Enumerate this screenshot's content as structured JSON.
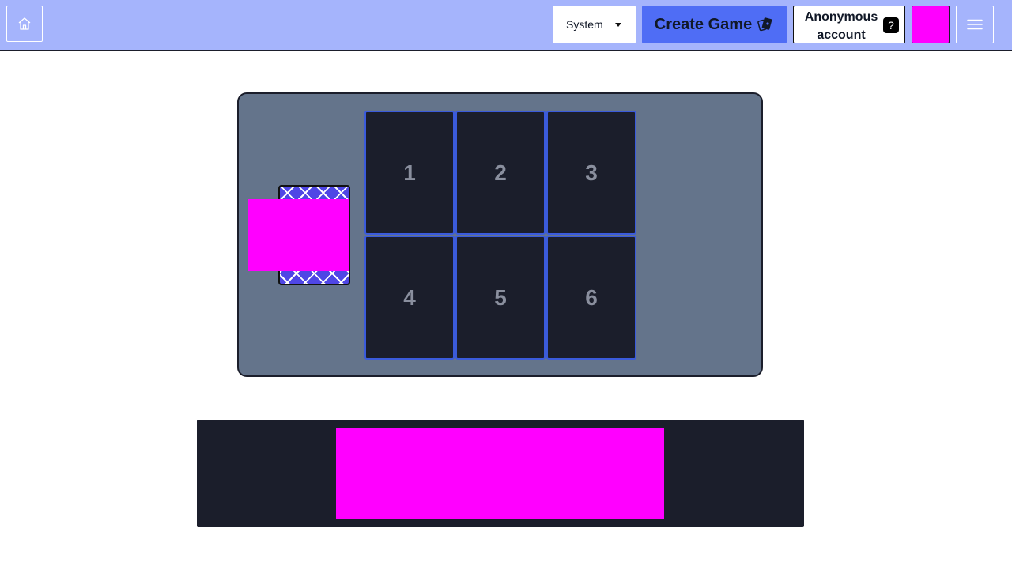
{
  "header": {
    "home_icon": "home-icon",
    "theme": {
      "selected": "System"
    },
    "create_game_label": "Create Game",
    "create_game_icon": "cards-icon",
    "account_label": "Anonymous account",
    "account_help": "?",
    "avatar_color": "#ff00ff",
    "menu_icon": "hamburger-menu-icon"
  },
  "board": {
    "background": "#64748b",
    "deck_color": "#4f46e5",
    "slots": [
      {
        "label": "1"
      },
      {
        "label": "2"
      },
      {
        "label": "3"
      },
      {
        "label": "4"
      },
      {
        "label": "5"
      },
      {
        "label": "6"
      }
    ]
  },
  "hand": {
    "background": "#1b1e2b",
    "card_color": "#ff00ff"
  }
}
